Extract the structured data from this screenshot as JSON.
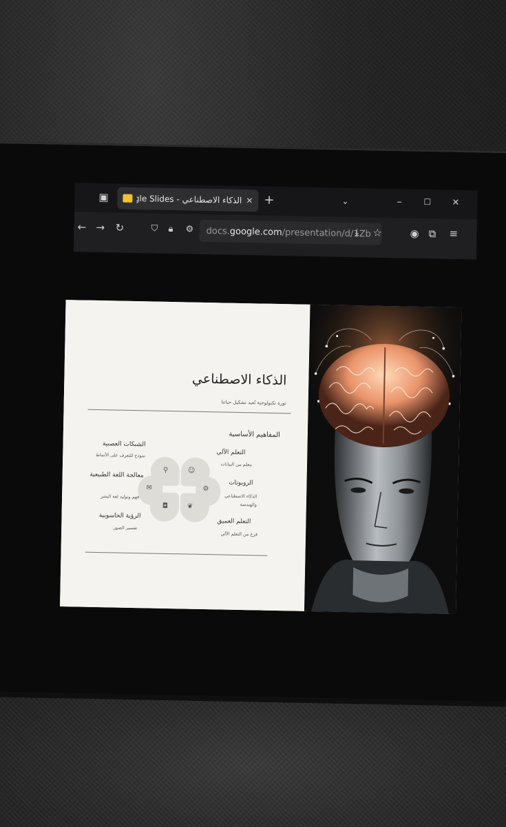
{
  "browser": {
    "tab_title": "الذكاء الاصطناعي - Google Slides",
    "tab_close": "✕",
    "new_tab": "+",
    "url_prefix": "docs.",
    "url_domain": "google.com",
    "url_path": "/presentation/d/1Zb"
  },
  "slide": {
    "title": "الذكاء الاصطناعي",
    "subtitle": "ثورة تكنولوجية تُعيد تشكيل حياتنا",
    "section_title": "المفاهيم الأساسية",
    "right_concepts": [
      {
        "title": "التعلم الآلي",
        "desc": "يتعلم من البيانات"
      },
      {
        "title": "الروبوتات",
        "desc": "الذكاء الاصطناعي والهندسة"
      },
      {
        "title": "التعلم العميق",
        "desc": "فرع من التعلم الآلي"
      }
    ],
    "left_concepts": [
      {
        "title": "الشبكات العصبية",
        "desc": "نموذج للتعرف على الأنماط"
      },
      {
        "title": "معالجة اللغة الطبيعية",
        "desc": "فهم وتوليد لغة البشر"
      },
      {
        "title": "الرؤية الحاسوبية",
        "desc": "تفسير الصور"
      }
    ]
  },
  "colors": {
    "accent": "#f1c232",
    "slide_bg": "#f4f3ef",
    "brain_glow": "#f3a97a"
  }
}
